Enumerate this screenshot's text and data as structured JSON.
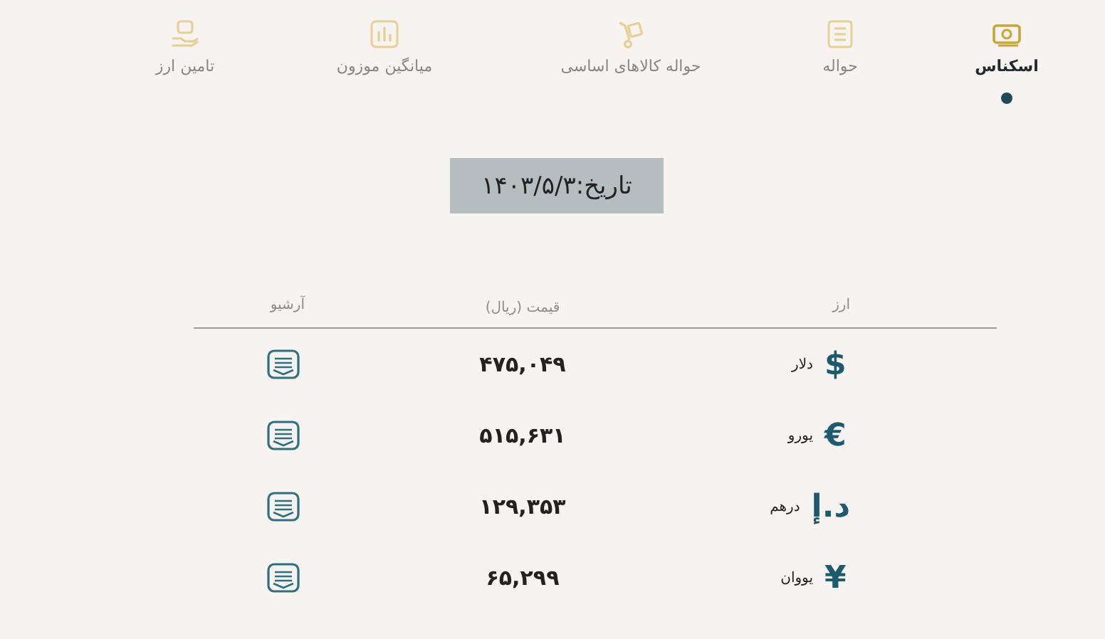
{
  "tabs": [
    {
      "label": "اسکناس",
      "kind": "cash",
      "selected": true
    },
    {
      "label": "حواله",
      "kind": "list",
      "selected": false
    },
    {
      "label": "حواله کالاهای اساسی",
      "kind": "cart",
      "selected": false
    },
    {
      "label": "میانگین موزون",
      "kind": "chart",
      "selected": false
    },
    {
      "label": "تامین ارز",
      "kind": "hand",
      "selected": false
    }
  ],
  "date": "تاریخ:۱۴۰۳/۵/۳",
  "table": {
    "columns": [
      "ارز",
      "قیمت (ریال)",
      "آرشیو"
    ],
    "rows": [
      {
        "symbol": "$",
        "currency": "دلار",
        "price": "۴۷۵,۰۴۹"
      },
      {
        "symbol": "€",
        "currency": "یورو",
        "price": "۵۱۵,۶۳۱"
      },
      {
        "symbol": "د.إ",
        "currency": "درهم",
        "price": "۱۲۹,۳۵۳"
      },
      {
        "symbol": "¥",
        "currency": "یووان",
        "price": "۶۵,۲۹۹"
      }
    ]
  }
}
